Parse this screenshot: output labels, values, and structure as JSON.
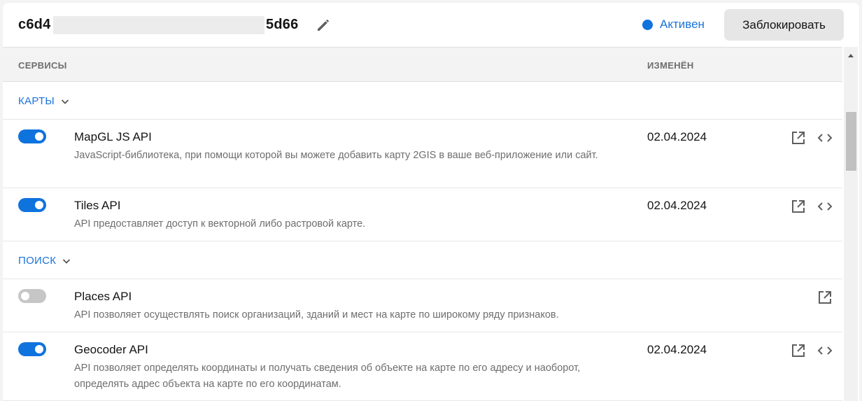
{
  "header": {
    "key_prefix": "c6d4",
    "key_suffix": "5d66",
    "status_label": "Активен",
    "block_button": "Заблокировать"
  },
  "columns": {
    "services": "СЕРВИСЫ",
    "changed": "ИЗМЕНЁН"
  },
  "groups": [
    {
      "label": "КАРТЫ",
      "services": [
        {
          "enabled": true,
          "name": "MapGL JS API",
          "description": "JavaScript-библиотека, при помощи которой вы можете добавить карту 2GIS в ваше веб-приложение или сайт.",
          "changed": "02.04.2024"
        },
        {
          "enabled": true,
          "name": "Tiles API",
          "description": "API предоставляет доступ к векторной либо растровой карте.",
          "changed": "02.04.2024"
        }
      ]
    },
    {
      "label": "ПОИСК",
      "services": [
        {
          "enabled": false,
          "name": "Places API",
          "description": "API позволяет осуществлять поиск организаций, зданий и мест на карте по широкому ряду признаков.",
          "changed": ""
        },
        {
          "enabled": true,
          "name": "Geocoder API",
          "description": "API позволяет определять координаты и получать сведения об объекте на карте по его адресу и наоборот, определять адрес объекта на карте по его координатам.",
          "changed": "02.04.2024"
        }
      ]
    }
  ],
  "colors": {
    "accent": "#0f73de",
    "toggle_off": "#c6c6c6",
    "muted_text": "#6e6e6e"
  }
}
